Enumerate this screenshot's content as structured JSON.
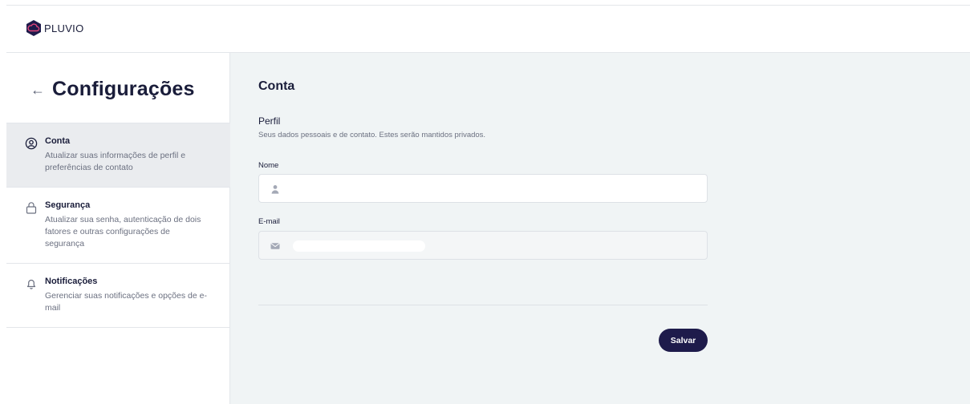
{
  "brand": {
    "name": "PLUVIO",
    "logo_icon": "pluvio-logo-icon",
    "color": "#1e1b4b"
  },
  "sidebar": {
    "back_icon": "arrow-left-icon",
    "title": "Configurações",
    "items": [
      {
        "title": "Conta",
        "description": "Atualizar suas informações de perfil e preferências de contato",
        "icon": "user-circle-icon",
        "active": true
      },
      {
        "title": "Segurança",
        "description": "Atualizar sua senha, autenticação de dois fatores e outras configurações de segurança",
        "icon": "lock-icon",
        "active": false
      },
      {
        "title": "Notificações",
        "description": "Gerenciar suas notificações e opções de e-mail",
        "icon": "bell-icon",
        "active": false
      }
    ]
  },
  "main": {
    "title": "Conta",
    "section": {
      "title": "Perfil",
      "subtitle": "Seus dados pessoais e de contato. Estes serão mantidos privados."
    },
    "fields": {
      "name": {
        "label": "Nome",
        "value": "",
        "placeholder": "",
        "icon": "user-icon"
      },
      "email": {
        "label": "E-mail",
        "value": "",
        "icon": "mail-icon",
        "disabled": true
      }
    },
    "save_label": "Salvar"
  },
  "colors": {
    "accent": "#1e1b4b",
    "main_bg": "#f0f4f5",
    "active_item_bg": "#eaecef"
  }
}
